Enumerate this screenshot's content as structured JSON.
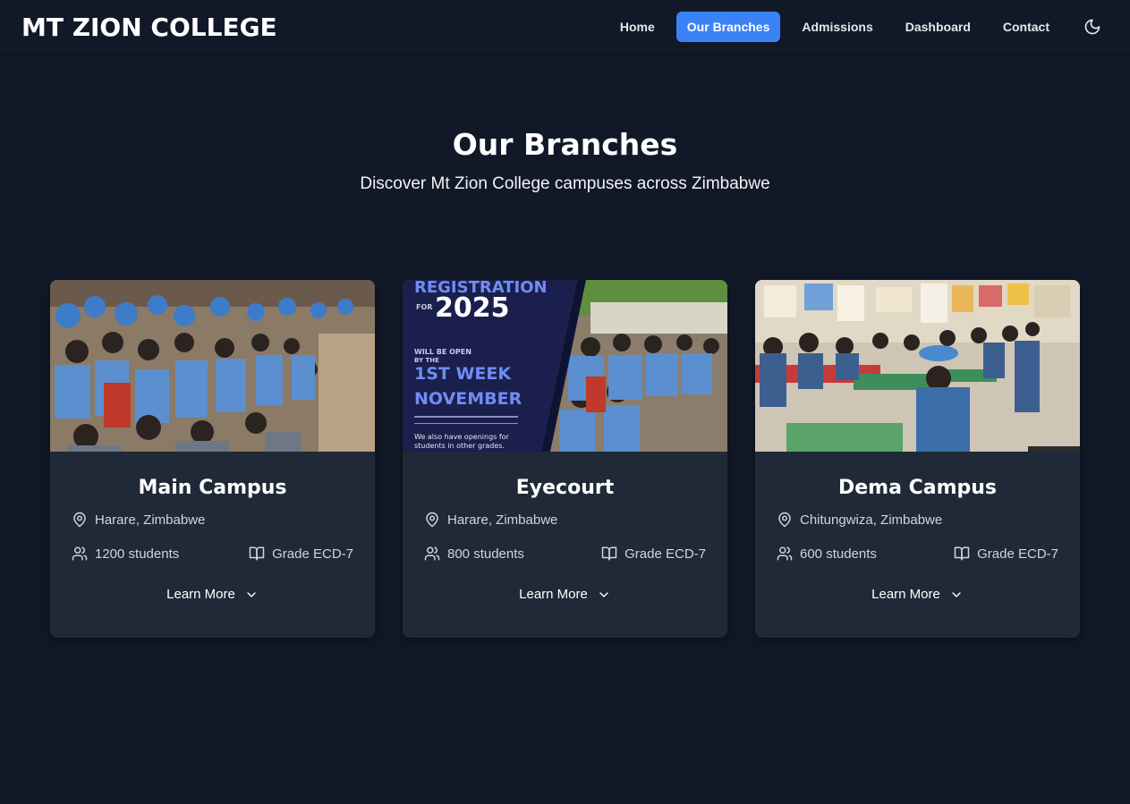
{
  "nav": {
    "brand": "MT ZION COLLEGE",
    "links": [
      {
        "label": "Home"
      },
      {
        "label": "Our Branches",
        "active": true
      },
      {
        "label": "Admissions"
      },
      {
        "label": "Dashboard"
      },
      {
        "label": "Contact"
      }
    ],
    "theme_icon": "moon-icon"
  },
  "hero": {
    "title": "Our Branches",
    "subtitle": "Discover Mt Zion College campuses across Zimbabwe"
  },
  "branches": [
    {
      "name": "Main Campus",
      "location": "Harare, Zimbabwe",
      "students": "1200 students",
      "grades": "Grade ECD-7",
      "cta": "Learn More",
      "image": "photo of students in blue uniforms assembled outdoors"
    },
    {
      "name": "Eyecourt",
      "location": "Harare, Zimbabwe",
      "students": "800 students",
      "grades": "Grade ECD-7",
      "cta": "Learn More",
      "image": "registration banner with students",
      "banner": {
        "line1": "REGISTRATION",
        "line2": "FOR",
        "line3": "2025",
        "line4": "WILL BE OPEN",
        "line5": "BY THE",
        "line6": "1ST WEEK",
        "line7": "NOVEMBER",
        "line8": "We also have openings for",
        "line9": "students in other grades."
      }
    },
    {
      "name": "Dema Campus",
      "location": "Chitungwiza, Zimbabwe",
      "students": "600 students",
      "grades": "Grade ECD-7",
      "cta": "Learn More",
      "image": "classroom photo with children at desks"
    }
  ],
  "colors": {
    "background": "#111827",
    "card": "#1f2937",
    "accent": "#3b82f6"
  }
}
